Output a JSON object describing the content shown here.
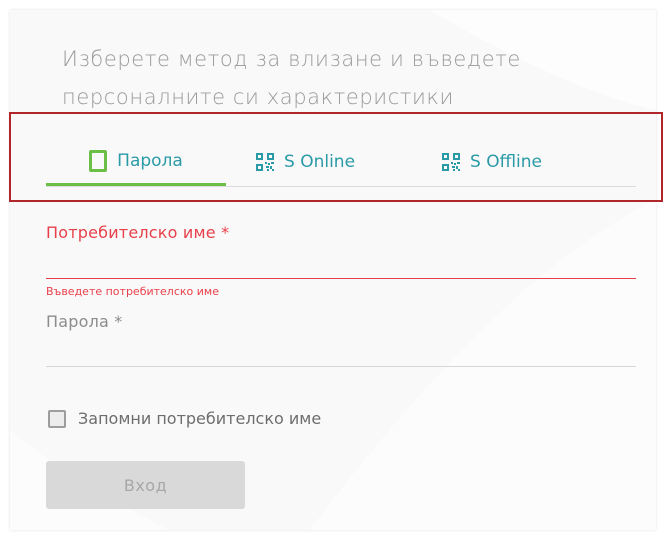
{
  "intro": {
    "line1": "Изберете метод за влизане и въведете",
    "line2": "персоналните си характеристики"
  },
  "tabs": [
    {
      "label": "Парола",
      "icon": "phone-icon",
      "active": true
    },
    {
      "label": "S Online",
      "icon": "qr-code-icon",
      "active": false
    },
    {
      "label": "S Offline",
      "icon": "qr-code-icon",
      "active": false
    }
  ],
  "form": {
    "username_label": "Потребителско име *",
    "username_value": "",
    "username_error": "Въведете потребителско име",
    "password_label": "Парола *",
    "password_value": "",
    "remember_label": "Запомни потребителско име",
    "remember_checked": false,
    "login_label": "Вход"
  },
  "colors": {
    "accent_green": "#6cbf46",
    "tab_teal": "#2a9aa7",
    "error_red": "#e8404a",
    "highlight_red": "#b0262b"
  }
}
